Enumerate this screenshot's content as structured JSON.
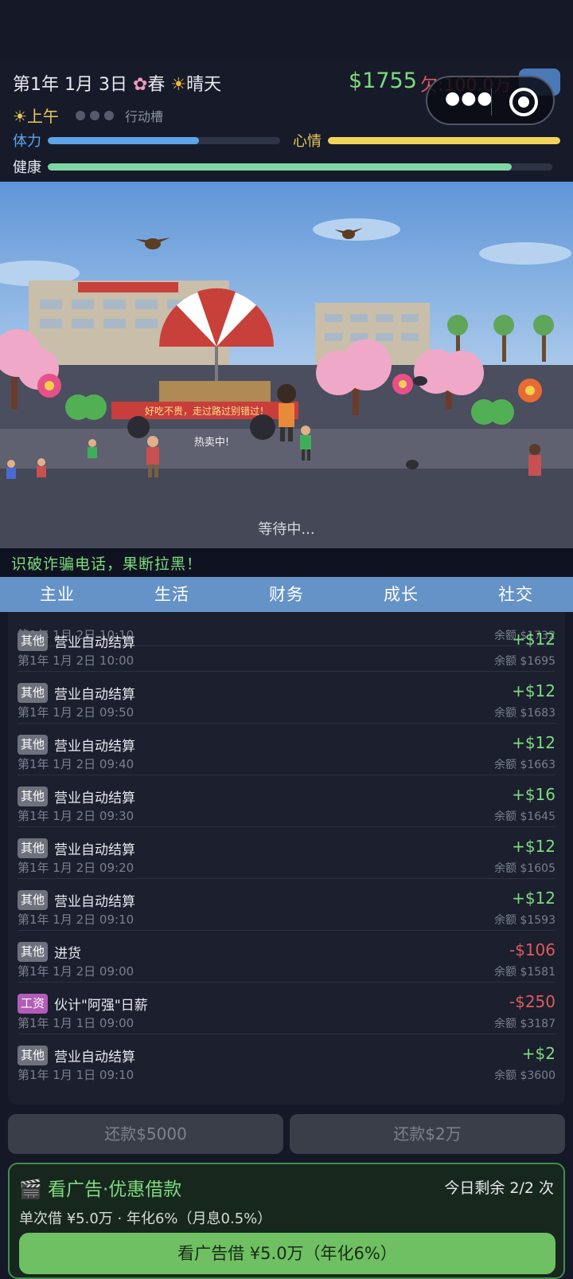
{
  "header": {
    "date": "第1年 1月 3日",
    "season": "春",
    "weather": "晴天",
    "money": "$1755",
    "debt": "欠:100.0万",
    "time_of_day": "上午",
    "slots_label": "行动槽",
    "slots_used": 0,
    "slots_total": 3
  },
  "stats": [
    {
      "label": "体力",
      "fill": 0.65,
      "label_color": "#5fa4e8",
      "color": "#5fa4e8"
    },
    {
      "label": "心情",
      "fill": 1.0,
      "label_color": "#e8c85a",
      "color": "#f2d45c"
    },
    {
      "label": "健康",
      "fill": 0.92,
      "label_color": "#e6e8ee",
      "color": "#7fd6a4"
    }
  ],
  "scene": {
    "sign": "好吃不贵，走过路过别错过！",
    "hot_sale": "热卖中!",
    "waiting": "等待中..."
  },
  "banner": "识破诈骗电话，果断拉黑！",
  "tabs": [
    "主业",
    "生活",
    "财务",
    "成长",
    "社交"
  ],
  "ledger": {
    "partial": {
      "time": "第1年 1月 2日 10:10",
      "balance": "余额 $1732"
    },
    "rows": [
      {
        "badge": "其他",
        "title": "营业自动结算",
        "time": "第1年 1月 2日 10:00",
        "amount": "+$12",
        "balance": "余额 $1695"
      },
      {
        "badge": "其他",
        "title": "营业自动结算",
        "time": "第1年 1月 2日 09:50",
        "amount": "+$12",
        "balance": "余额 $1683"
      },
      {
        "badge": "其他",
        "title": "营业自动结算",
        "time": "第1年 1月 2日 09:40",
        "amount": "+$12",
        "balance": "余额 $1663"
      },
      {
        "badge": "其他",
        "title": "营业自动结算",
        "time": "第1年 1月 2日 09:30",
        "amount": "+$16",
        "balance": "余额 $1645"
      },
      {
        "badge": "其他",
        "title": "营业自动结算",
        "time": "第1年 1月 2日 09:20",
        "amount": "+$12",
        "balance": "余额 $1605"
      },
      {
        "badge": "其他",
        "title": "营业自动结算",
        "time": "第1年 1月 2日 09:10",
        "amount": "+$12",
        "balance": "余额 $1593"
      },
      {
        "badge": "其他",
        "title": "进货",
        "time": "第1年 1月 2日 09:00",
        "amount": "-$106",
        "balance": "余额 $1581"
      },
      {
        "badge": "工资",
        "title": "伙计\"阿强\"日薪",
        "time": "第1年 1月 1日 09:00",
        "amount": "-$250",
        "balance": "余额 $3187"
      },
      {
        "badge": "其他",
        "title": "营业自动结算",
        "time": "第1年 1月 1日 09:10",
        "amount": "+$2",
        "balance": "余额 $3600"
      }
    ]
  },
  "buttons": {
    "repay_5000": "还款$5000",
    "repay_2w": "还款$2万"
  },
  "ad": {
    "title": "看广告·优惠借款",
    "remaining": "今日剩余 2/2 次",
    "sub": "单次借 ¥5.0万 · 年化6%（月息0.5%）",
    "button": "看广告借 ¥5.0万（年化6%）"
  },
  "colors": {
    "positive": "#7ddb7d",
    "negative": "#e05a5a",
    "badge_other": "#6d717c",
    "badge_wage": "#b25db8"
  }
}
